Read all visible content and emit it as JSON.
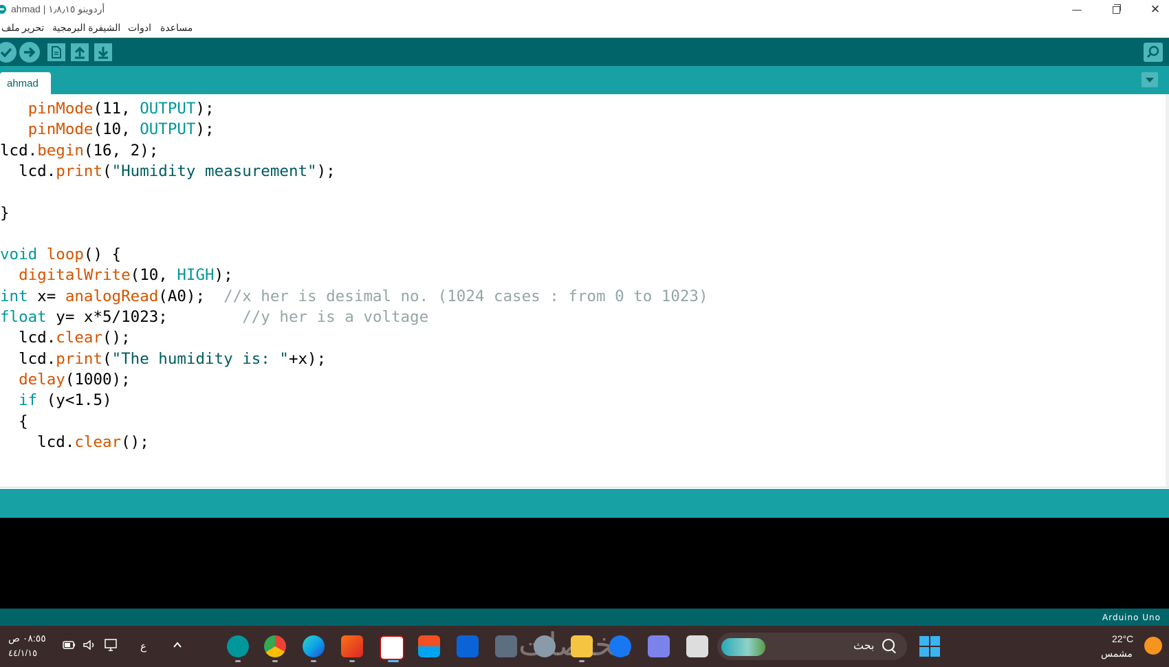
{
  "window": {
    "title": "ahmad | أردوينو ١٫٨٫١٥",
    "minimize": "—",
    "close": "✕"
  },
  "menu": {
    "file": "ملف",
    "edit": "تحرير",
    "sketch": "الشيفرة البرمجية",
    "tools": "ادوات",
    "help": "مساعدة"
  },
  "tabs": [
    {
      "label": "ahmad"
    }
  ],
  "code_lines": [
    "   pinMode(11, OUTPUT);",
    "   pinMode(10, OUTPUT);",
    "lcd.begin(16, 2);",
    "  lcd.print(\"Humidity measurement\");",
    "",
    "}",
    "",
    "void loop() {",
    "  digitalWrite(10, HIGH);",
    "int x= analogRead(A0);  //x her is desimal no. (1024 cases : from 0 to 1023)",
    "float y= x*5/1023;        //y her is a voltage",
    "  lcd.clear();",
    "  lcd.print(\"The humidity is: \"+x);",
    "  delay(1000);",
    "  if (y<1.5)",
    "  {",
    "    lcd.clear();"
  ],
  "status": {
    "board": "Arduino Uno"
  },
  "taskbar": {
    "time": "٠٨:٥٥ ص",
    "date": "٤٤/١/١٥",
    "lang": "ع",
    "search_label": "بحث",
    "weather_temp": "22°C",
    "weather_cond": "مشمس",
    "watermark": "مختصات"
  },
  "colors": {
    "toolbar": "#006468",
    "tabbar": "#17a1a5",
    "keyword": "#d35400",
    "constant": "#00979c",
    "comment": "#95a5a6"
  }
}
